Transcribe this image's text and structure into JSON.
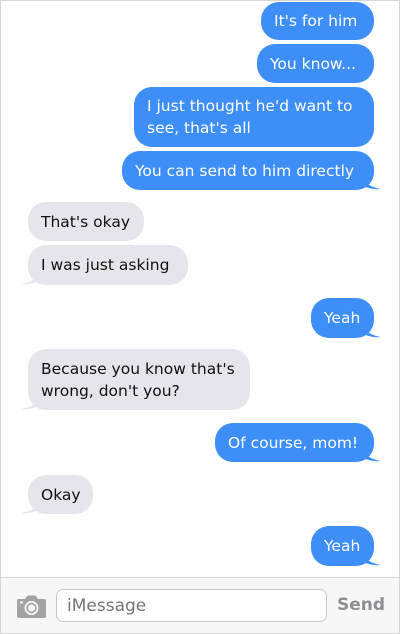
{
  "messages": [
    {
      "side": "sent",
      "text": "It's for him"
    },
    {
      "side": "sent",
      "text": "You know..."
    },
    {
      "side": "sent",
      "text": "I just thought he'd want to\nsee, that's all"
    },
    {
      "side": "sent",
      "text": "You can send to him directly"
    },
    {
      "side": "recv",
      "text": "That's okay"
    },
    {
      "side": "recv",
      "text": "I was just asking"
    },
    {
      "side": "sent",
      "text": "Yeah"
    },
    {
      "side": "recv",
      "text": "Because you know that's\nwrong, don't you?"
    },
    {
      "side": "sent",
      "text": "Of course, mom!"
    },
    {
      "side": "recv",
      "text": "Okay"
    },
    {
      "side": "sent",
      "text": "Yeah"
    }
  ],
  "composer": {
    "placeholder": "iMessage",
    "send_label": "Send",
    "camera_icon": "camera-icon"
  },
  "colors": {
    "sent_bubble": "#3e8ef7",
    "received_bubble": "#e6e5eb",
    "send_text": "#8e8e93"
  }
}
